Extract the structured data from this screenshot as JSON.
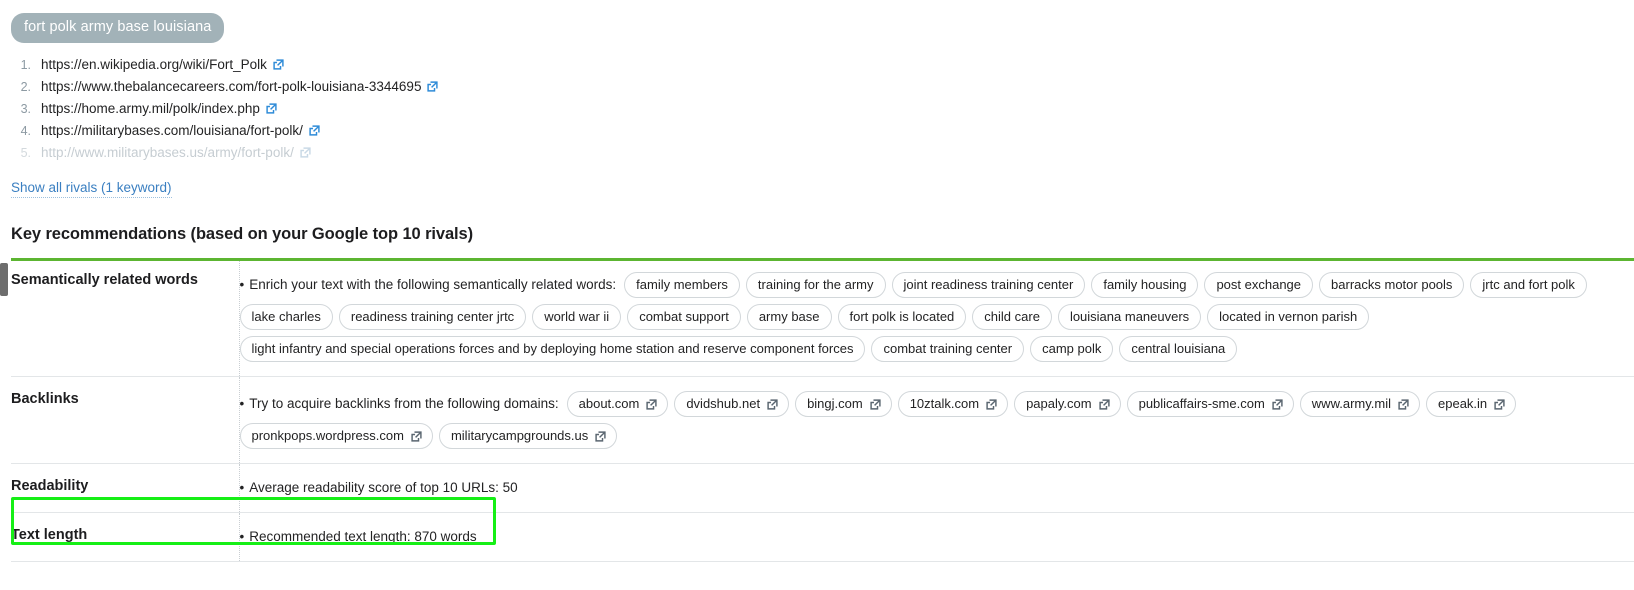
{
  "keyword_pill": {
    "label": "fort polk army base louisiana"
  },
  "rivals": {
    "items": [
      {
        "num": "1.",
        "url": "https://en.wikipedia.org/wiki/Fort_Polk",
        "faded": false
      },
      {
        "num": "2.",
        "url": "https://www.thebalancecareers.com/fort-polk-louisiana-3344695",
        "faded": false
      },
      {
        "num": "3.",
        "url": "https://home.army.mil/polk/index.php",
        "faded": false
      },
      {
        "num": "4.",
        "url": "https://militarybases.com/louisiana/fort-polk/",
        "faded": false
      },
      {
        "num": "5.",
        "url": "http://www.militarybases.us/army/fort-polk/",
        "faded": true
      }
    ],
    "show_all_label": "Show all rivals (1 keyword)"
  },
  "section": {
    "title": "Key recommendations (based on your Google top 10 rivals)"
  },
  "rows": {
    "semantic": {
      "label": "Semantically related words",
      "lead": "Enrich your text with the following semantically related words:",
      "tags": [
        "family members",
        "training for the army",
        "joint readiness training center",
        "family housing",
        "post exchange",
        "barracks motor pools",
        "jrtc and fort polk",
        "lake charles",
        "readiness training center jrtc",
        "world war ii",
        "combat support",
        "army base",
        "fort polk is located",
        "child care",
        "louisiana maneuvers",
        "located in vernon parish",
        "light infantry and special operations forces and by deploying home station and reserve component forces",
        "combat training center",
        "camp polk",
        "central louisiana"
      ]
    },
    "backlinks": {
      "label": "Backlinks",
      "lead": "Try to acquire backlinks from the following domains:",
      "domains": [
        "about.com",
        "dvidshub.net",
        "bingj.com",
        "10ztalk.com",
        "papaly.com",
        "publicaffairs-sme.com",
        "www.army.mil",
        "epeak.in",
        "pronkpops.wordpress.com",
        "militarycampgrounds.us"
      ]
    },
    "readability": {
      "label": "Readability",
      "text": "Average readability score of top 10 URLs:  50"
    },
    "text_length": {
      "label": "Text length",
      "text": "Recommended text length:  870 words"
    }
  },
  "icons": {
    "external_link": "external-link-icon"
  },
  "colors": {
    "pill_bg": "#a2b2b8",
    "accent_green": "#5cb531",
    "highlight_green": "#16ef16",
    "link_blue": "#3a7fc1"
  }
}
